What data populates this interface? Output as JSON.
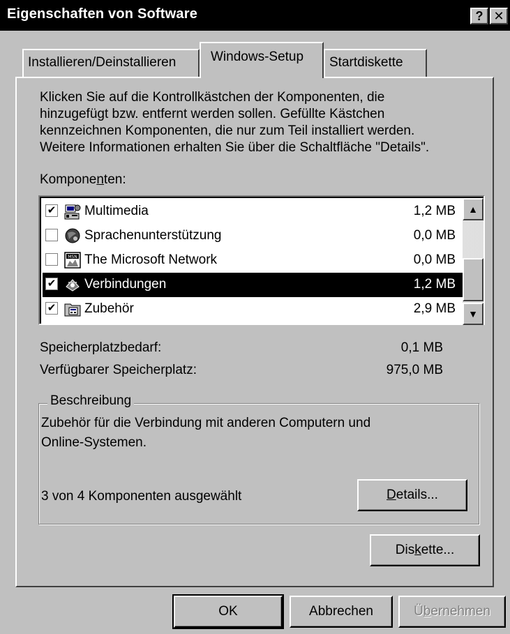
{
  "window": {
    "title": "Eigenschaften von Software",
    "help_button": "?",
    "close_button": "✕"
  },
  "tabs": [
    {
      "label": "Installieren/Deinstallieren",
      "active": false
    },
    {
      "label": "Windows-Setup",
      "active": true
    },
    {
      "label": "Startdiskette",
      "active": false
    }
  ],
  "intro_lines": [
    "Klicken Sie auf die Kontrollkästchen der Komponenten, die",
    "hinzugefügt bzw. entfernt werden sollen. Gefüllte Kästchen",
    "kennzeichnen Komponenten, die nur zum Teil installiert werden.",
    "Weitere Informationen erhalten Sie über die Schaltfläche \"Details\"."
  ],
  "components_label": {
    "before": "Kompone",
    "mnemonic": "n",
    "after": "ten:"
  },
  "components": [
    {
      "name": "Multimedia",
      "size": "1,2 MB",
      "checked": true,
      "selected": false,
      "icon": "multimedia-icon"
    },
    {
      "name": "Sprachenunterstützung",
      "size": "0,0 MB",
      "checked": false,
      "selected": false,
      "icon": "globe-icon"
    },
    {
      "name": "The Microsoft Network",
      "size": "0,0 MB",
      "checked": false,
      "selected": false,
      "icon": "msn-icon"
    },
    {
      "name": "Verbindungen",
      "size": "1,2 MB",
      "checked": true,
      "selected": true,
      "icon": "connection-icon"
    },
    {
      "name": "Zubehör",
      "size": "2,9 MB",
      "checked": true,
      "selected": false,
      "icon": "accessories-icon"
    }
  ],
  "space": {
    "required_label": "Speicherplatzbedarf:",
    "required_value": "0,1 MB",
    "available_label": "Verfügbarer Speicherplatz:",
    "available_value": "975,0 MB"
  },
  "description": {
    "group_title": "Beschreibung",
    "text_line1": "Zubehör für die Verbindung mit anderen Computern und",
    "text_line2": "Online-Systemen.",
    "selected_count": "3 von 4 Komponenten ausgewählt",
    "details_button": {
      "mnemonic": "D",
      "after": "etails..."
    }
  },
  "disk_button": {
    "before": "Dis",
    "mnemonic": "k",
    "after": "ette..."
  },
  "footer": {
    "ok": "OK",
    "cancel": "Abbrechen",
    "apply": {
      "before": "Ü",
      "mnemonic": "b",
      "after": "ernehmen"
    }
  },
  "colors": {
    "face": "#c0c0c0",
    "selection": "#000000",
    "titlebar": "#000000"
  }
}
